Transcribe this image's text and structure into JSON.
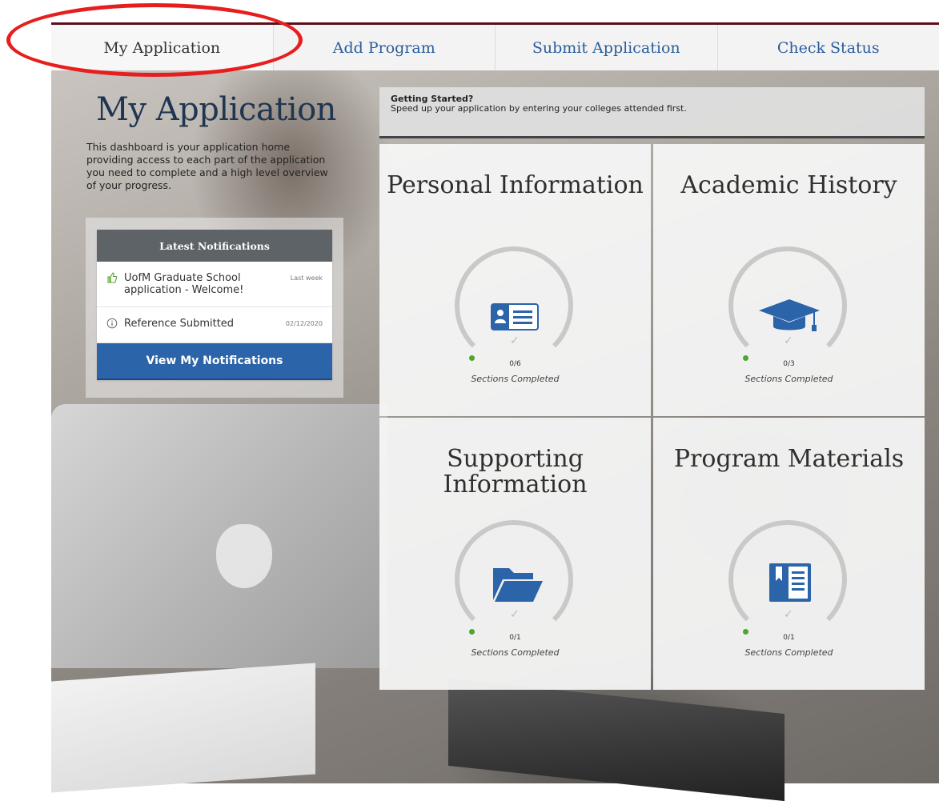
{
  "nav": {
    "tabs": [
      {
        "label": "My Application"
      },
      {
        "label": "Add Program"
      },
      {
        "label": "Submit Application"
      },
      {
        "label": "Check Status"
      }
    ]
  },
  "page": {
    "title": "My Application",
    "description": "This dashboard is your application home providing access to each part of the application you need to complete and a high level overview of your progress."
  },
  "notifications": {
    "header": "Latest Notifications",
    "items": [
      {
        "text": "UofM Graduate School application - Welcome!",
        "time": "Last week",
        "icon": "thumbs-up-icon"
      },
      {
        "text": "Reference Submitted",
        "time": "02/12/2020",
        "icon": "info-icon"
      }
    ],
    "button": "View My Notifications"
  },
  "getting_started": {
    "title": "Getting Started?",
    "text": "Speed up your application by entering your colleges attended first."
  },
  "sections": [
    {
      "name": "Personal Information",
      "count": "0/6",
      "label": "Sections Completed",
      "icon": "id-card-icon"
    },
    {
      "name": "Academic History",
      "count": "0/3",
      "label": "Sections Completed",
      "icon": "graduation-cap-icon"
    },
    {
      "name": "Supporting Information",
      "count": "0/1",
      "label": "Sections Completed",
      "icon": "folder-icon"
    },
    {
      "name": "Program Materials",
      "count": "0/1",
      "label": "Sections Completed",
      "icon": "book-icon"
    }
  ],
  "colors": {
    "brand": "#5b0f1a",
    "link": "#2a5d9c",
    "button": "#2b64a9",
    "annotation": "#e61e1e",
    "progress_dot": "#4aa82b"
  }
}
